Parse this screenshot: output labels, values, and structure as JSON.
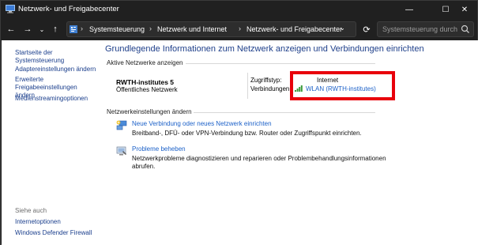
{
  "window": {
    "title": "Netzwerk- und Freigabecenter",
    "controls": {
      "minimize": "—",
      "maximize": "☐",
      "close": "✕"
    }
  },
  "nav": {
    "back": "←",
    "forward": "→",
    "recent": "⌄",
    "up": "↑",
    "refresh": "⟳",
    "breadcrumb": [
      "Systemsteuerung",
      "Netzwerk und Internet",
      "Netzwerk- und Freigabecenter"
    ],
    "separator": "›",
    "dropdown": "⌄"
  },
  "search": {
    "placeholder": "Systemsteuerung durch..."
  },
  "sidebar": {
    "links": [
      "Startseite der Systemsteuerung",
      "Adaptereinstellungen ändern",
      "Erweiterte Freigabeeinstellungen ändern",
      "Medienstreamingoptionen"
    ],
    "see_also_heading": "Siehe auch",
    "see_also": [
      "Internetoptionen",
      "Windows Defender Firewall"
    ]
  },
  "main": {
    "heading": "Grundlegende Informationen zum Netzwerk anzeigen und Verbindungen einrichten",
    "active_networks_label": "Aktive Netzwerke anzeigen",
    "network": {
      "name": "RWTH-institutes 5",
      "type": "Öffentliches Netzwerk",
      "access_type_label": "Zugriffstyp:",
      "access_type_value": "Internet",
      "connections_label": "Verbindungen:",
      "connection_link": "WLAN (RWTH-institutes)"
    },
    "change_settings_label": "Netzwerkeinstellungen ändern",
    "settings": [
      {
        "link": "Neue Verbindung oder neues Netzwerk einrichten",
        "description": "Breitband-, DFÜ- oder VPN-Verbindung bzw. Router oder Zugriffspunkt einrichten."
      },
      {
        "link": "Probleme beheben",
        "description": "Netzwerkprobleme diagnostizieren und reparieren oder Problembehandlungsinformationen abrufen."
      }
    ]
  },
  "colors": {
    "titlebar_bg": "#202020",
    "link_blue": "#1b60c8",
    "heading_blue": "#1e3f8a",
    "highlight_red": "#e8000b"
  }
}
